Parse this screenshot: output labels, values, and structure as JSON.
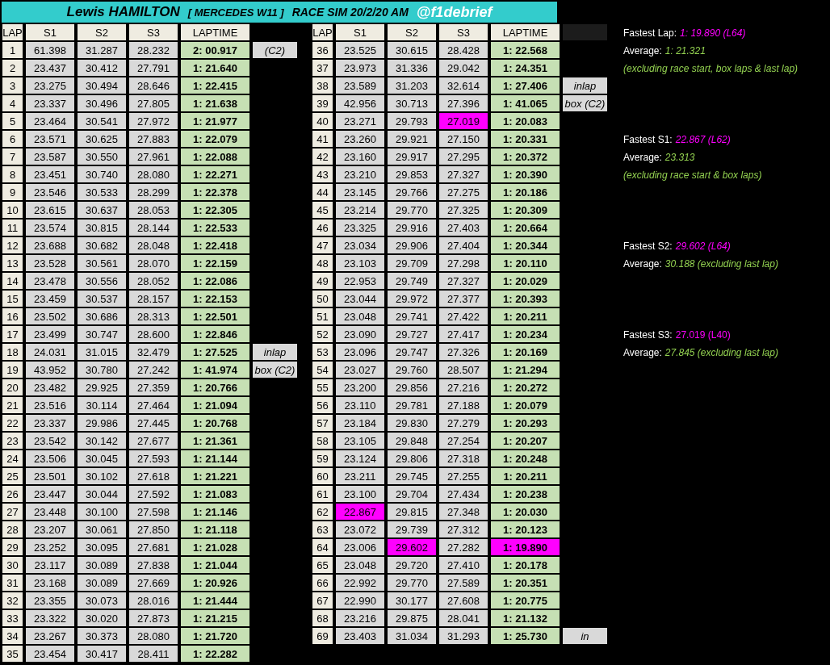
{
  "title": [
    {
      "kind": "driver",
      "text": "Lewis HAMILTON"
    },
    {
      "kind": "car",
      "text": "[ MERCEDES W11 ]"
    },
    {
      "kind": "session",
      "text": "RACE SIM  20/2/20 AM"
    },
    {
      "kind": "handle",
      "text": "@f1debrief"
    }
  ],
  "lap_tables": [
    {
      "columns": [
        "LAP",
        "S1",
        "S2",
        "S3",
        "LAPTIME"
      ],
      "blank_header": false,
      "rows": [
        {
          "lap": "1",
          "s1": "61.398",
          "s2": "31.287",
          "s3": "28.232",
          "laptime": "2: 00.917",
          "note": "(C2)"
        },
        {
          "lap": "2",
          "s1": "23.437",
          "s2": "30.412",
          "s3": "27.791",
          "laptime": "1: 21.640"
        },
        {
          "lap": "3",
          "s1": "23.275",
          "s2": "30.494",
          "s3": "28.646",
          "laptime": "1: 22.415"
        },
        {
          "lap": "4",
          "s1": "23.337",
          "s2": "30.496",
          "s3": "27.805",
          "laptime": "1: 21.638"
        },
        {
          "lap": "5",
          "s1": "23.464",
          "s2": "30.541",
          "s3": "27.972",
          "laptime": "1: 21.977"
        },
        {
          "lap": "6",
          "s1": "23.571",
          "s2": "30.625",
          "s3": "27.883",
          "laptime": "1: 22.079"
        },
        {
          "lap": "7",
          "s1": "23.587",
          "s2": "30.550",
          "s3": "27.961",
          "laptime": "1: 22.088"
        },
        {
          "lap": "8",
          "s1": "23.451",
          "s2": "30.740",
          "s3": "28.080",
          "laptime": "1: 22.271"
        },
        {
          "lap": "9",
          "s1": "23.546",
          "s2": "30.533",
          "s3": "28.299",
          "laptime": "1: 22.378"
        },
        {
          "lap": "10",
          "s1": "23.615",
          "s2": "30.637",
          "s3": "28.053",
          "laptime": "1: 22.305"
        },
        {
          "lap": "11",
          "s1": "23.574",
          "s2": "30.815",
          "s3": "28.144",
          "laptime": "1: 22.533"
        },
        {
          "lap": "12",
          "s1": "23.688",
          "s2": "30.682",
          "s3": "28.048",
          "laptime": "1: 22.418"
        },
        {
          "lap": "13",
          "s1": "23.528",
          "s2": "30.561",
          "s3": "28.070",
          "laptime": "1: 22.159"
        },
        {
          "lap": "14",
          "s1": "23.478",
          "s2": "30.556",
          "s3": "28.052",
          "laptime": "1: 22.086"
        },
        {
          "lap": "15",
          "s1": "23.459",
          "s2": "30.537",
          "s3": "28.157",
          "laptime": "1: 22.153"
        },
        {
          "lap": "16",
          "s1": "23.502",
          "s2": "30.686",
          "s3": "28.313",
          "laptime": "1: 22.501"
        },
        {
          "lap": "17",
          "s1": "23.499",
          "s2": "30.747",
          "s3": "28.600",
          "laptime": "1: 22.846"
        },
        {
          "lap": "18",
          "s1": "24.031",
          "s2": "31.015",
          "s3": "32.479",
          "laptime": "1: 27.525",
          "note": "inlap"
        },
        {
          "lap": "19",
          "s1": "43.952",
          "s2": "30.780",
          "s3": "27.242",
          "laptime": "1: 41.974",
          "note": "box (C2)"
        },
        {
          "lap": "20",
          "s1": "23.482",
          "s2": "29.925",
          "s3": "27.359",
          "laptime": "1: 20.766"
        },
        {
          "lap": "21",
          "s1": "23.516",
          "s2": "30.114",
          "s3": "27.464",
          "laptime": "1: 21.094"
        },
        {
          "lap": "22",
          "s1": "23.337",
          "s2": "29.986",
          "s3": "27.445",
          "laptime": "1: 20.768"
        },
        {
          "lap": "23",
          "s1": "23.542",
          "s2": "30.142",
          "s3": "27.677",
          "laptime": "1: 21.361"
        },
        {
          "lap": "24",
          "s1": "23.506",
          "s2": "30.045",
          "s3": "27.593",
          "laptime": "1: 21.144"
        },
        {
          "lap": "25",
          "s1": "23.501",
          "s2": "30.102",
          "s3": "27.618",
          "laptime": "1: 21.221"
        },
        {
          "lap": "26",
          "s1": "23.447",
          "s2": "30.044",
          "s3": "27.592",
          "laptime": "1: 21.083"
        },
        {
          "lap": "27",
          "s1": "23.448",
          "s2": "30.100",
          "s3": "27.598",
          "laptime": "1: 21.146"
        },
        {
          "lap": "28",
          "s1": "23.207",
          "s2": "30.061",
          "s3": "27.850",
          "laptime": "1: 21.118"
        },
        {
          "lap": "29",
          "s1": "23.252",
          "s2": "30.095",
          "s3": "27.681",
          "laptime": "1: 21.028"
        },
        {
          "lap": "30",
          "s1": "23.117",
          "s2": "30.089",
          "s3": "27.838",
          "laptime": "1: 21.044"
        },
        {
          "lap": "31",
          "s1": "23.168",
          "s2": "30.089",
          "s3": "27.669",
          "laptime": "1: 20.926"
        },
        {
          "lap": "32",
          "s1": "23.355",
          "s2": "30.073",
          "s3": "28.016",
          "laptime": "1: 21.444"
        },
        {
          "lap": "33",
          "s1": "23.322",
          "s2": "30.020",
          "s3": "27.873",
          "laptime": "1: 21.215"
        },
        {
          "lap": "34",
          "s1": "23.267",
          "s2": "30.373",
          "s3": "28.080",
          "laptime": "1: 21.720"
        },
        {
          "lap": "35",
          "s1": "23.454",
          "s2": "30.417",
          "s3": "28.411",
          "laptime": "1: 22.282"
        }
      ]
    },
    {
      "columns": [
        "LAP",
        "S1",
        "S2",
        "S3",
        "LAPTIME"
      ],
      "blank_header": true,
      "rows": [
        {
          "lap": "36",
          "s1": "23.525",
          "s2": "30.615",
          "s3": "28.428",
          "laptime": "1: 22.568"
        },
        {
          "lap": "37",
          "s1": "23.973",
          "s2": "31.336",
          "s3": "29.042",
          "laptime": "1: 24.351"
        },
        {
          "lap": "38",
          "s1": "23.589",
          "s2": "31.203",
          "s3": "32.614",
          "laptime": "1: 27.406",
          "note": "inlap"
        },
        {
          "lap": "39",
          "s1": "42.956",
          "s2": "30.713",
          "s3": "27.396",
          "laptime": "1: 41.065",
          "note": "box (C2)"
        },
        {
          "lap": "40",
          "s1": "23.271",
          "s2": "29.793",
          "s3": "27.019",
          "laptime": "1: 20.083",
          "s3_fastest": true
        },
        {
          "lap": "41",
          "s1": "23.260",
          "s2": "29.921",
          "s3": "27.150",
          "laptime": "1: 20.331"
        },
        {
          "lap": "42",
          "s1": "23.160",
          "s2": "29.917",
          "s3": "27.295",
          "laptime": "1: 20.372"
        },
        {
          "lap": "43",
          "s1": "23.210",
          "s2": "29.853",
          "s3": "27.327",
          "laptime": "1: 20.390"
        },
        {
          "lap": "44",
          "s1": "23.145",
          "s2": "29.766",
          "s3": "27.275",
          "laptime": "1: 20.186"
        },
        {
          "lap": "45",
          "s1": "23.214",
          "s2": "29.770",
          "s3": "27.325",
          "laptime": "1: 20.309"
        },
        {
          "lap": "46",
          "s1": "23.325",
          "s2": "29.916",
          "s3": "27.403",
          "laptime": "1: 20.664"
        },
        {
          "lap": "47",
          "s1": "23.034",
          "s2": "29.906",
          "s3": "27.404",
          "laptime": "1: 20.344"
        },
        {
          "lap": "48",
          "s1": "23.103",
          "s2": "29.709",
          "s3": "27.298",
          "laptime": "1: 20.110"
        },
        {
          "lap": "49",
          "s1": "22.953",
          "s2": "29.749",
          "s3": "27.327",
          "laptime": "1: 20.029"
        },
        {
          "lap": "50",
          "s1": "23.044",
          "s2": "29.972",
          "s3": "27.377",
          "laptime": "1: 20.393"
        },
        {
          "lap": "51",
          "s1": "23.048",
          "s2": "29.741",
          "s3": "27.422",
          "laptime": "1: 20.211"
        },
        {
          "lap": "52",
          "s1": "23.090",
          "s2": "29.727",
          "s3": "27.417",
          "laptime": "1: 20.234"
        },
        {
          "lap": "53",
          "s1": "23.096",
          "s2": "29.747",
          "s3": "27.326",
          "laptime": "1: 20.169"
        },
        {
          "lap": "54",
          "s1": "23.027",
          "s2": "29.760",
          "s3": "28.507",
          "laptime": "1: 21.294"
        },
        {
          "lap": "55",
          "s1": "23.200",
          "s2": "29.856",
          "s3": "27.216",
          "laptime": "1: 20.272"
        },
        {
          "lap": "56",
          "s1": "23.110",
          "s2": "29.781",
          "s3": "27.188",
          "laptime": "1: 20.079"
        },
        {
          "lap": "57",
          "s1": "23.184",
          "s2": "29.830",
          "s3": "27.279",
          "laptime": "1: 20.293"
        },
        {
          "lap": "58",
          "s1": "23.105",
          "s2": "29.848",
          "s3": "27.254",
          "laptime": "1: 20.207"
        },
        {
          "lap": "59",
          "s1": "23.124",
          "s2": "29.806",
          "s3": "27.318",
          "laptime": "1: 20.248"
        },
        {
          "lap": "60",
          "s1": "23.211",
          "s2": "29.745",
          "s3": "27.255",
          "laptime": "1: 20.211"
        },
        {
          "lap": "61",
          "s1": "23.100",
          "s2": "29.704",
          "s3": "27.434",
          "laptime": "1: 20.238"
        },
        {
          "lap": "62",
          "s1": "22.867",
          "s2": "29.815",
          "s3": "27.348",
          "laptime": "1: 20.030",
          "s1_fastest": true
        },
        {
          "lap": "63",
          "s1": "23.072",
          "s2": "29.739",
          "s3": "27.312",
          "laptime": "1: 20.123"
        },
        {
          "lap": "64",
          "s1": "23.006",
          "s2": "29.602",
          "s3": "27.282",
          "laptime": "1: 19.890",
          "s2_fastest": true,
          "laptime_fastest": true
        },
        {
          "lap": "65",
          "s1": "23.048",
          "s2": "29.720",
          "s3": "27.410",
          "laptime": "1: 20.178"
        },
        {
          "lap": "66",
          "s1": "22.992",
          "s2": "29.770",
          "s3": "27.589",
          "laptime": "1: 20.351"
        },
        {
          "lap": "67",
          "s1": "22.990",
          "s2": "30.177",
          "s3": "27.608",
          "laptime": "1: 20.775"
        },
        {
          "lap": "68",
          "s1": "23.216",
          "s2": "29.875",
          "s3": "28.041",
          "laptime": "1: 21.132"
        },
        {
          "lap": "69",
          "s1": "23.403",
          "s2": "31.034",
          "s3": "31.293",
          "laptime": "1: 25.730",
          "note": "in"
        }
      ]
    }
  ],
  "stats": [
    {
      "lines": [
        {
          "label": "Fastest Lap:",
          "value": "1: 19.890 (L64)",
          "kind": "fastest"
        },
        {
          "label": "Average:",
          "value": "1: 21.321",
          "kind": "average"
        },
        {
          "value": "(excluding race start, box laps & last lap)",
          "kind": "note"
        }
      ]
    },
    {
      "lines": [
        {
          "label": "Fastest S1:",
          "value": "22.867 (L62)",
          "kind": "fastest"
        },
        {
          "label": "Average:",
          "value": "23.313",
          "kind": "average"
        },
        {
          "value": "(excluding race start & box laps)",
          "kind": "note"
        }
      ]
    },
    {
      "lines": [
        {
          "label": "Fastest S2:",
          "value": "29.602 (L64)",
          "kind": "fastest"
        },
        {
          "label": "Average:",
          "value": "30.188 (excluding last lap)",
          "kind": "average"
        }
      ]
    },
    {
      "lines": [
        {
          "label": "Fastest S3:",
          "value": "27.019 (L40)",
          "kind": "fastest_upright"
        },
        {
          "label": "Average:",
          "value": "27.845  (excluding last lap)",
          "kind": "average"
        }
      ]
    }
  ]
}
